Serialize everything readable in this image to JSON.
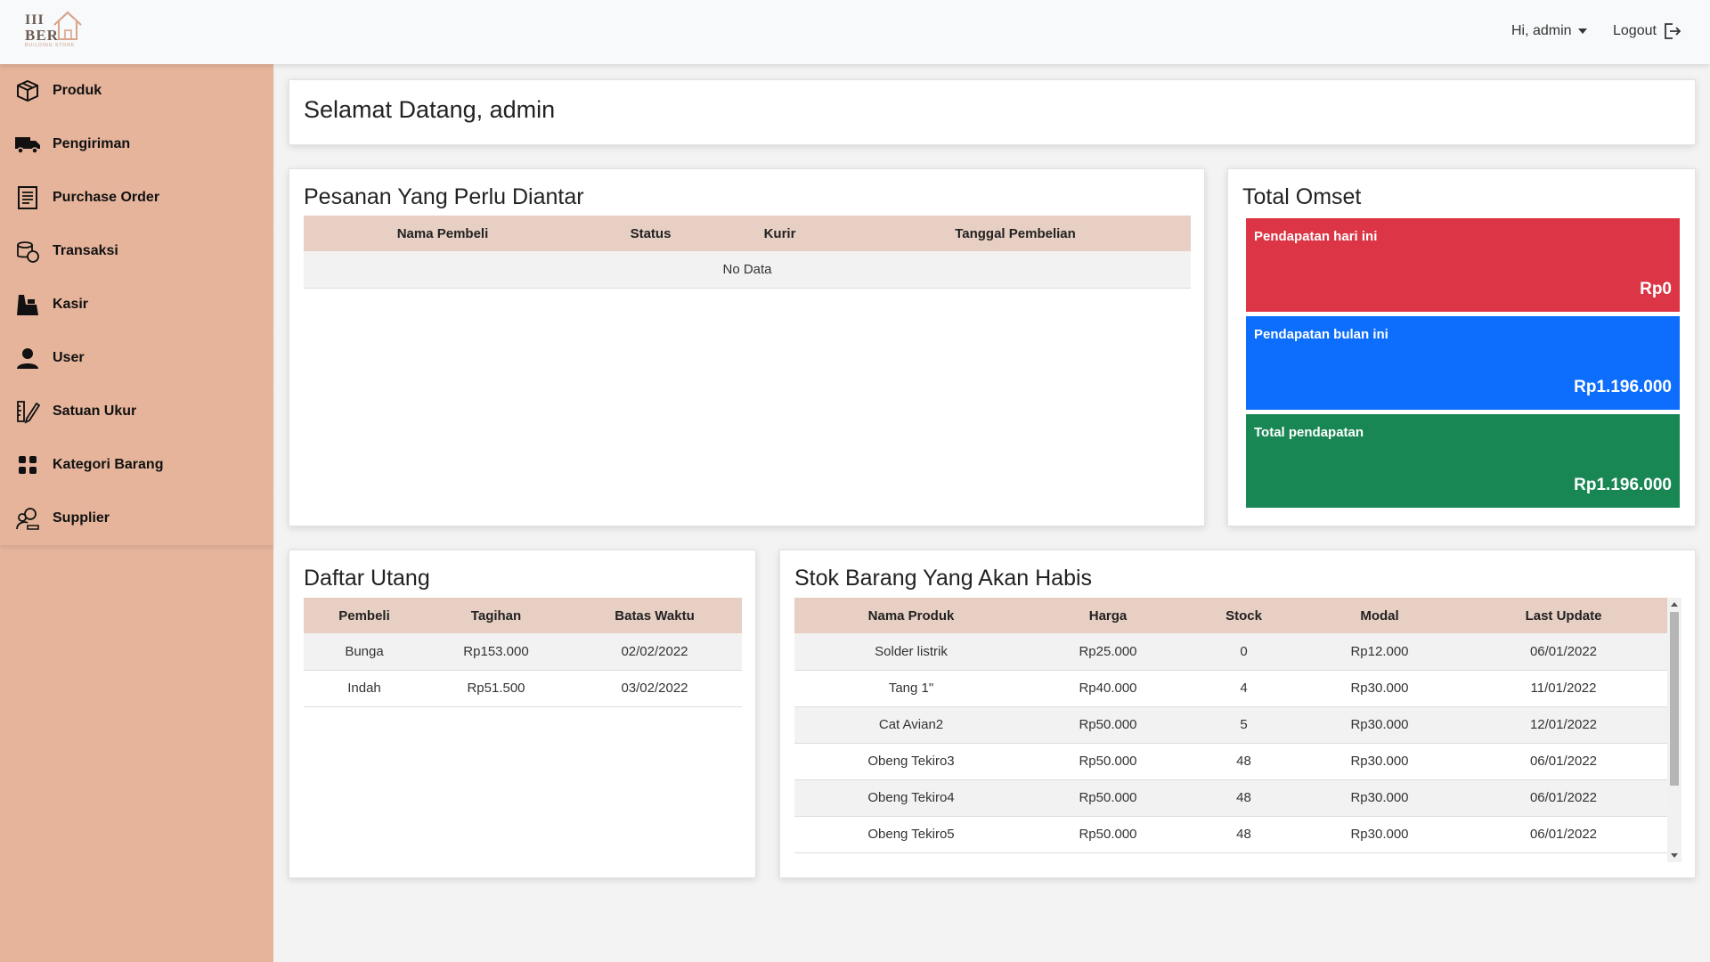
{
  "navbar": {
    "logo": {
      "line1": "III",
      "line2": "BER",
      "sub": "BUILDING STORE"
    },
    "user_label": "Hi, admin",
    "logout_label": "Logout"
  },
  "sidebar": {
    "items": [
      {
        "label": "Produk",
        "icon": "box-icon"
      },
      {
        "label": "Pengiriman",
        "icon": "truck-icon"
      },
      {
        "label": "Purchase Order",
        "icon": "receipt-icon"
      },
      {
        "label": "Transaksi",
        "icon": "coins-icon"
      },
      {
        "label": "Kasir",
        "icon": "cashier-icon"
      },
      {
        "label": "User",
        "icon": "user-icon"
      },
      {
        "label": "Satuan Ukur",
        "icon": "ruler-pencil-icon"
      },
      {
        "label": "Kategori Barang",
        "icon": "grid-icon"
      },
      {
        "label": "Supplier",
        "icon": "supplier-icon"
      }
    ]
  },
  "welcome": {
    "title": "Selamat Datang, admin"
  },
  "pesanan": {
    "title": "Pesanan Yang Perlu Diantar",
    "columns": [
      "Nama Pembeli",
      "Status",
      "Kurir",
      "Tanggal Pembelian"
    ],
    "empty": "No Data"
  },
  "omset": {
    "title": "Total Omset",
    "colors": {
      "today": "#dc3545",
      "month": "#0d6efd",
      "total": "#198754"
    },
    "boxes": [
      {
        "label": "Pendapatan hari ini",
        "value": "Rp0"
      },
      {
        "label": "Pendapatan bulan ini",
        "value": "Rp1.196.000"
      },
      {
        "label": "Total pendapatan",
        "value": "Rp1.196.000"
      }
    ]
  },
  "utang": {
    "title": "Daftar Utang",
    "columns": [
      "Pembeli",
      "Tagihan",
      "Batas Waktu"
    ],
    "rows": [
      [
        "Bunga",
        "Rp153.000",
        "02/02/2022"
      ],
      [
        "Indah",
        "Rp51.500",
        "03/02/2022"
      ]
    ]
  },
  "stok": {
    "title": "Stok Barang Yang Akan Habis",
    "columns": [
      "Nama Produk",
      "Harga",
      "Stock",
      "Modal",
      "Last Update"
    ],
    "rows": [
      [
        "Solder listrik",
        "Rp25.000",
        "0",
        "Rp12.000",
        "06/01/2022"
      ],
      [
        "Tang 1\"",
        "Rp40.000",
        "4",
        "Rp30.000",
        "11/01/2022"
      ],
      [
        "Cat Avian2",
        "Rp50.000",
        "5",
        "Rp30.000",
        "12/01/2022"
      ],
      [
        "Obeng Tekiro3",
        "Rp50.000",
        "48",
        "Rp30.000",
        "06/01/2022"
      ],
      [
        "Obeng Tekiro4",
        "Rp50.000",
        "48",
        "Rp30.000",
        "06/01/2022"
      ],
      [
        "Obeng Tekiro5",
        "Rp50.000",
        "48",
        "Rp30.000",
        "06/01/2022"
      ]
    ]
  }
}
